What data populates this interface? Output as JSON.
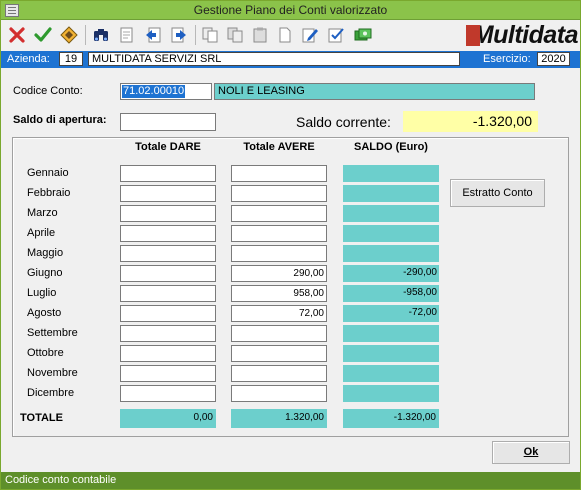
{
  "window": {
    "title": "Gestione Piano dei Conti valorizzato"
  },
  "toolbar": {
    "icons": [
      "close-icon",
      "confirm-check-icon",
      "diamond-icon",
      "binoculars-search-icon",
      "print-preview-icon",
      "back-arrow-icon",
      "forward-arrow-icon",
      "copy-document-icon",
      "paste-document-icon",
      "clipboard-icon",
      "new-document-icon",
      "edit-document-icon",
      "checklist-icon",
      "payment-icon"
    ]
  },
  "logo": {
    "text": "Multidata"
  },
  "azienda": {
    "label": "Azienda:",
    "code": "19",
    "name": "MULTIDATA SERVIZI SRL",
    "esercizio_label": "Esercizio:",
    "esercizio": "2020"
  },
  "conto": {
    "label": "Codice Conto:",
    "code": "71.02.00010",
    "description": "NOLI E LEASING"
  },
  "saldo": {
    "apertura_label": "Saldo di apertura:",
    "apertura": "",
    "corrente_label": "Saldo corrente:",
    "corrente": "-1.320,00"
  },
  "table": {
    "headers": [
      "Totale DARE",
      "Totale AVERE",
      "SALDO (Euro)"
    ],
    "rows": [
      {
        "month": "Gennaio",
        "dare": "",
        "avere": "",
        "saldo": ""
      },
      {
        "month": "Febbraio",
        "dare": "",
        "avere": "",
        "saldo": ""
      },
      {
        "month": "Marzo",
        "dare": "",
        "avere": "",
        "saldo": ""
      },
      {
        "month": "Aprile",
        "dare": "",
        "avere": "",
        "saldo": ""
      },
      {
        "month": "Maggio",
        "dare": "",
        "avere": "",
        "saldo": ""
      },
      {
        "month": "Giugno",
        "dare": "",
        "avere": "290,00",
        "saldo": "-290,00"
      },
      {
        "month": "Luglio",
        "dare": "",
        "avere": "958,00",
        "saldo": "-958,00"
      },
      {
        "month": "Agosto",
        "dare": "",
        "avere": "72,00",
        "saldo": "-72,00"
      },
      {
        "month": "Settembre",
        "dare": "",
        "avere": "",
        "saldo": ""
      },
      {
        "month": "Ottobre",
        "dare": "",
        "avere": "",
        "saldo": ""
      },
      {
        "month": "Novembre",
        "dare": "",
        "avere": "",
        "saldo": ""
      },
      {
        "month": "Dicembre",
        "dare": "",
        "avere": "",
        "saldo": ""
      }
    ],
    "total": {
      "label": "TOTALE",
      "dare": "0,00",
      "avere": "1.320,00",
      "saldo": "-1.320,00"
    }
  },
  "buttons": {
    "estratto": "Estratto Conto",
    "ok": "Ok"
  },
  "status": {
    "text": "Codice conto contabile"
  },
  "colors": {
    "title_bar": "#8bc34a",
    "azienda_bar": "#1e73d2",
    "saldo_cell": "#6ccfcc",
    "saldo_corrente": "#ffffa6",
    "status_bar": "#5e8f2a"
  }
}
